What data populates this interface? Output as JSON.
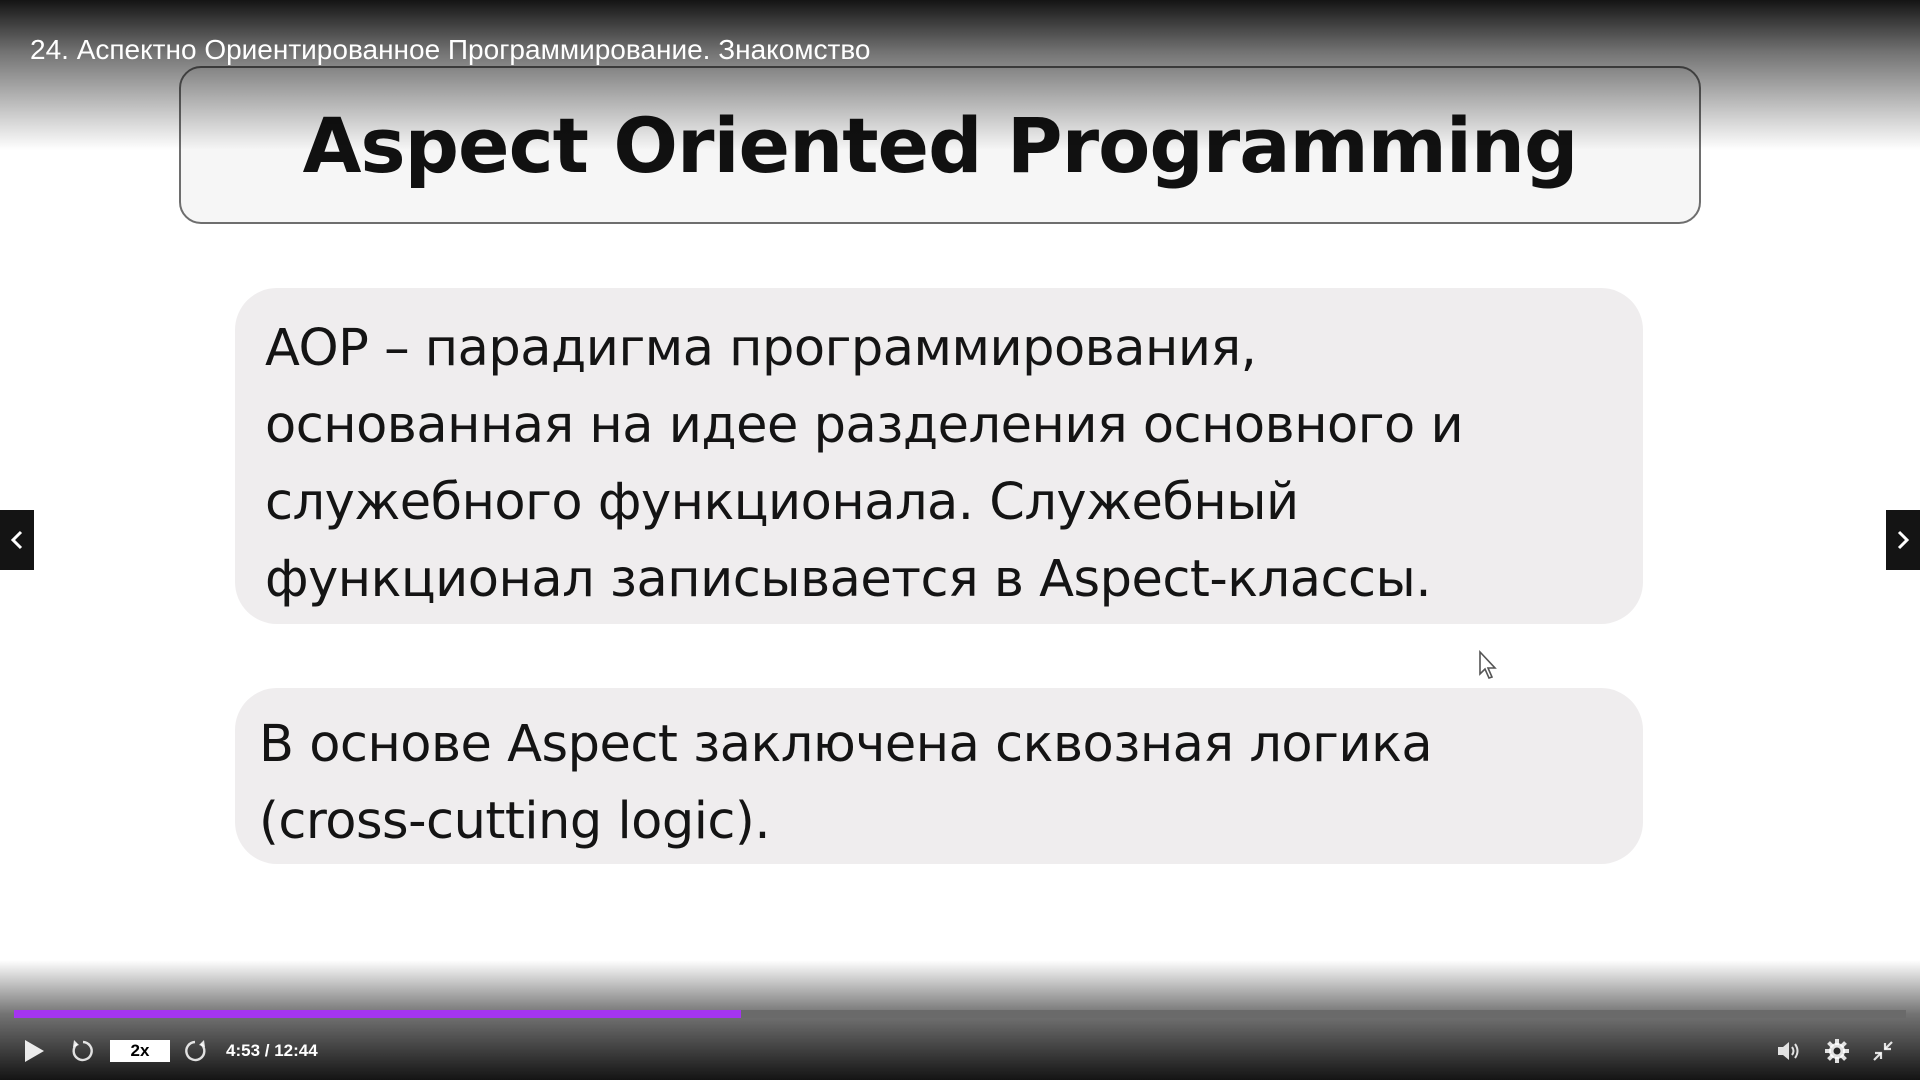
{
  "video": {
    "title": "24. Аспектно Ориентированное Программирование. Знакомство"
  },
  "slide": {
    "heading": "Aspect Oriented Programming",
    "box1_lines": [
      "AOP – парадигма программирования,",
      "основанная на идее разделения основного и",
      "служебного функционала. Служебный",
      "функционал записывается в Aspect-классы."
    ],
    "box2_lines": [
      "В основе Aspect заключена сквозная логика",
      "(cross-cutting logic)."
    ]
  },
  "player": {
    "speed_label": "2x",
    "time_display": "4:53 / 12:44",
    "progress_fraction": 0.384,
    "accent_color": "#a435f0",
    "icons": {
      "play": "play-icon",
      "rewind": "rewind-icon",
      "forward": "forward-icon",
      "volume": "volume-icon",
      "settings": "gear-icon",
      "exit_fullscreen": "exit-fullscreen-icon",
      "prev": "chevron-left-icon",
      "next": "chevron-right-icon"
    }
  }
}
